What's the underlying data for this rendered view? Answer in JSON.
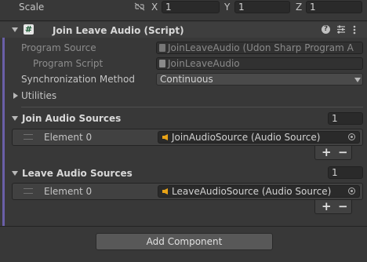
{
  "transform": {
    "scale_label": "Scale",
    "x_label": "X",
    "x_value": "1",
    "y_label": "Y",
    "y_value": "1",
    "z_label": "Z",
    "z_value": "1"
  },
  "component": {
    "hash_icon": "#",
    "title": "Join Leave Audio (Script)",
    "program_source_label": "Program Source",
    "program_source_value": "JoinLeaveAudio (Udon Sharp Program A",
    "program_script_label": "Program Script",
    "program_script_value": "JoinLeaveAudio",
    "sync_label": "Synchronization Method",
    "sync_value": "Continuous",
    "utilities_label": "Utilities"
  },
  "join_sources": {
    "label": "Join Audio Sources",
    "count": "1",
    "element_label": "Element 0",
    "element_value": "JoinAudioSource (Audio Source)"
  },
  "leave_sources": {
    "label": "Leave Audio Sources",
    "count": "1",
    "element_label": "Element 0",
    "element_value": "LeaveAudioSource (Audio Source)"
  },
  "list_buttons": {
    "add": "+",
    "remove": "−"
  },
  "add_component_label": "Add Component",
  "colors": {
    "accent_bar": "#6a5fa8",
    "audio_icon": "#e8a317"
  },
  "icons": [
    "scale-link-icon",
    "help-icon",
    "settings-icon",
    "menu-icon",
    "object-picker-icon",
    "audio-source-icon",
    "script-file-icon"
  ]
}
